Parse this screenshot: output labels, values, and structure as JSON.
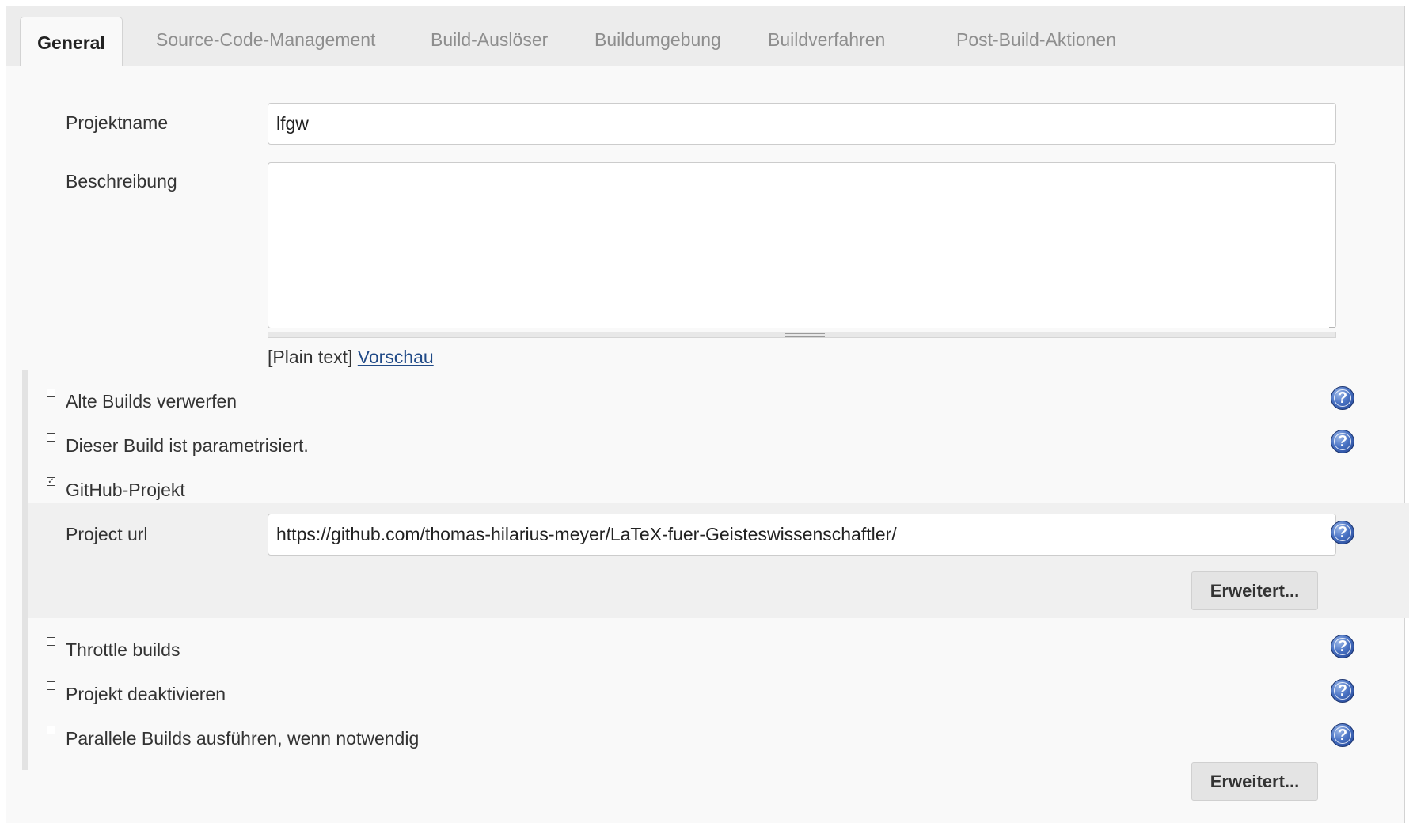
{
  "tabs": [
    {
      "label": "General"
    },
    {
      "label": "Source-Code-Management"
    },
    {
      "label": "Build-Auslöser"
    },
    {
      "label": "Buildumgebung"
    },
    {
      "label": "Buildverfahren"
    },
    {
      "label": "Post-Build-Aktionen"
    }
  ],
  "active_tab": "General",
  "form": {
    "project_name_label": "Projektname",
    "project_name_value": "lfgw",
    "description_label": "Beschreibung",
    "description_value": "",
    "markup_hint": "[Plain text]",
    "preview_link": "Vorschau"
  },
  "options": [
    {
      "label": "Alte Builds verwerfen",
      "checked": false,
      "help_icon": "help-icon"
    },
    {
      "label": "Dieser Build ist parametrisiert.",
      "checked": false,
      "help_icon": "help-icon"
    },
    {
      "label": "GitHub-Projekt",
      "checked": true
    },
    {
      "label": "Throttle builds",
      "checked": false,
      "help_icon": "help-icon"
    },
    {
      "label": "Projekt deaktivieren",
      "checked": false,
      "help_icon": "help-icon"
    },
    {
      "label": "Parallele Builds ausführen, wenn notwendig",
      "checked": false,
      "help_icon": "help-icon"
    }
  ],
  "github": {
    "project_url_label": "Project url",
    "project_url_value": "https://github.com/thomas-hilarius-meyer/LaTeX-fuer-Geisteswissenschaftler/",
    "advanced_button": "Erweitert..."
  },
  "footer": {
    "advanced_button": "Erweitert..."
  },
  "help_glyph": "?",
  "colors": {
    "link": "#204a87",
    "help_icon": "#3f63b5",
    "panel_bg": "#f9f9f9",
    "tabbar_bg": "#ececec"
  }
}
